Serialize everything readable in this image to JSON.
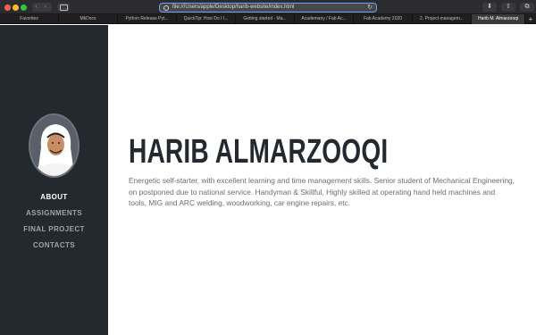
{
  "browser": {
    "address": "file:///Users/apple/Desktop/harib-website/index.html",
    "nav_arrows": "‹ ›",
    "download_glyph": "⬇",
    "share_glyph": "⇧",
    "tabs_glyph": "⧉",
    "reload_glyph": "↻"
  },
  "tabs": [
    {
      "label": "Favorites"
    },
    {
      "label": "MkDocs"
    },
    {
      "label": "Python Release Pyt..."
    },
    {
      "label": "QuickTip: How Do I I..."
    },
    {
      "label": "Getting started - Ma..."
    },
    {
      "label": "Academany / Fab Ac..."
    },
    {
      "label": "Fab Academy 2020"
    },
    {
      "label": "2. Project managem..."
    },
    {
      "label": "Harib M. Almarzooqi"
    }
  ],
  "tab_add": "+",
  "sidebar": {
    "items": [
      {
        "label": "ABOUT"
      },
      {
        "label": "ASSIGNMENTS"
      },
      {
        "label": "FINAL PROJECT"
      },
      {
        "label": "CONTACTS"
      }
    ]
  },
  "main": {
    "title": "HARIB ALMARZOOQI",
    "bio": "Energetic self-starter, with excellent learning and time management skills. Senior student of Mechanical Engineering, on postponed due to national service. Handyman & Skillful, Highly skilled at operating hand held machines and tools, MIG and ARC welding, woodworking, car engine repairs, etc."
  },
  "colors": {
    "sidebar_bg": "#23292e",
    "active_nav": "#ffffff",
    "nav": "#9fa3a6",
    "title": "#23292e",
    "bio": "#6b6e71"
  },
  "icons": [
    "close-icon",
    "minimize-icon",
    "zoom-icon",
    "sidebar-icon",
    "site-icon",
    "reload-icon",
    "download-icon",
    "share-icon",
    "tabs-icon",
    "add-tab-icon"
  ]
}
